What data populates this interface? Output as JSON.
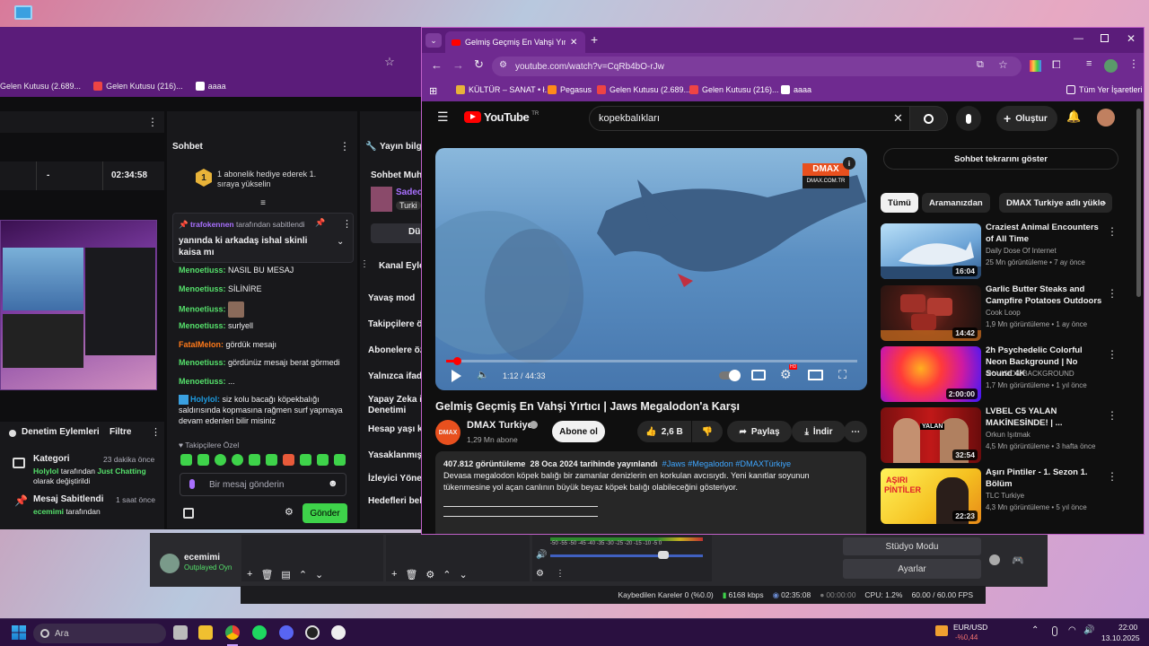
{
  "back_browser": {
    "bookmarks": [
      {
        "label": "Gelen Kutusu (2.689..."
      },
      {
        "label": "Gelen Kutusu (216)..."
      },
      {
        "label": "aaaa"
      }
    ],
    "stream_timer": "02:34:58",
    "stat_dash": "-",
    "chat": {
      "title": "Sohbet",
      "gift_text": "1 abonelik hediye ederek 1. sıraya yükselin",
      "gift_count": "1",
      "pinned_by_name": "trafokennen",
      "pinned_by_suffix": "tarafından sabitlendi",
      "pinned_text": "yanında ki arkadaş ishal skinli kaisa mı",
      "messages": [
        {
          "name": "Menoetiuss:",
          "text": "NASIL BU MESAJ",
          "color": "#55e06b"
        },
        {
          "name": "Menoetiuss:",
          "text": "SİLİNİRE",
          "color": "#55e06b"
        },
        {
          "name": "Menoetiuss:",
          "text": "",
          "color": "#55e06b"
        },
        {
          "name": "Menoetiuss:",
          "text": "surlyell",
          "color": "#55e06b"
        },
        {
          "name": "FatalMelon:",
          "text": "gördük mesajı",
          "color": "#ff7a1a"
        },
        {
          "name": "Menoetiuss:",
          "text": "gördünüz mesajı berat görmedi",
          "color": "#55e06b"
        },
        {
          "name": "Menoetiuss:",
          "text": "...",
          "color": "#55e06b"
        }
      ],
      "holy_name": "Holylol:",
      "holy_text": "siz kolu bacağı köpekbalığı saldırısında kopmasına rağmen surf yapmaya devam edenleri bilir misiniz",
      "followers_label": "Takipçilere Özel",
      "input_placeholder": "Bir mesaj gönderin",
      "send_label": "Gönder"
    },
    "info": {
      "title": "Yayın bilgi",
      "chat_label": "Sohbet Muh",
      "user_label": "Sadec",
      "tag_label": "Turki",
      "button_label": "Dü",
      "events_title": "Kanal Eyle",
      "items": [
        "Yavaş mod",
        "Takipçilere ö",
        "Abonelere öz",
        "Yalnızca ifad",
        "Yapay Zeka il",
        "Denetimi",
        "Hesap yaşı k",
        "Yasaklanmış",
        "İzleyici Yöne",
        "Hedefleri beli"
      ]
    },
    "moderation": {
      "title": "Denetim Eylemleri",
      "filter": "Filtre",
      "items": [
        {
          "title": "Kategori",
          "time": "23 dakika önce",
          "user": "Holylol",
          "mid": "tarafından",
          "target": "Just Chatting",
          "rest": "olarak değiştirildi"
        },
        {
          "title": "Mesaj Sabitlendi",
          "time": "1 saat önce",
          "user": "ecemimi",
          "mid": "tarafından",
          "target": "",
          "rest": ""
        }
      ]
    }
  },
  "front_browser": {
    "tab_title": "Gelmiş Geçmiş En Vahşi Yırtıcı |",
    "url": "youtube.com/watch?v=CqRb4bO-rJw",
    "bookmarks": [
      "KÜLTÜR – SANAT • ł...",
      "Pegasus",
      "Gelen Kutusu (2.689...",
      "Gelen Kutusu (216)...",
      "aaaa"
    ],
    "all_bookmarks": "Tüm Yer İşaretleri",
    "youtube": {
      "logo": "YouTube",
      "region": "TR",
      "search_value": "kopekbalıkları",
      "create_label": "Oluştur",
      "channel_badge": "DMAX",
      "channel_badge_sub": "DMAX.COM.TR",
      "time": "1:12 / 44:33",
      "progress": 0.027,
      "hd": "HD",
      "video_title": "Gelmiş Geçmiş En Vahşi Yırtıcı | Jaws Megalodon'a Karşı",
      "channel_name": "DMAX Turkiye",
      "channel_logo": "DMAX",
      "subs": "1,29 Mn abone",
      "subscribe": "Abone ol",
      "likes": "2,6 B",
      "share": "Paylaş",
      "download": "İndir",
      "views": "407.812 görüntüleme",
      "date": "28 Oca 2024 tarihinde yayınlandı",
      "hashtags": "#Jaws #Megalodon #DMAXTürkiye",
      "description": "Devasa megalodon köpek balığı bir zamanlar denizlerin en korkulan avcısıydı. Yeni kanıtlar soyunun tükenmesine yol açan canlının büyük beyaz köpek balığı olabileceğini gösteriyor.",
      "chat_replay": "Sohbet tekrarını göster",
      "chips": [
        "Tümü",
        "Aramanızdan",
        "DMAX Turkiye adlı yükle"
      ],
      "recommended": [
        {
          "title": "Craziest Animal Encounters of All Time",
          "channel": "Daily Dose Of Internet",
          "meta": "25 Mn görüntüleme • 7 ay önce",
          "duration": "16:04",
          "c1": "#9fd0f0",
          "c2": "#3b6ea8"
        },
        {
          "title": "Garlic Butter Steaks and Campfire Potatoes Outdoors",
          "channel": "Cook Loop",
          "meta": "1,9 Mn görüntüleme • 1 ay önce",
          "duration": "14:42",
          "c1": "#6a2a1e",
          "c2": "#2b1a14"
        },
        {
          "title": "2h Psychedelic Colorful Neon Background | No Sound 4K",
          "channel": "4K VISION BACKGROUND",
          "meta": "1,7 Mn görüntüleme • 1 yıl önce",
          "duration": "2:00:00",
          "c1": "#ff2aa0",
          "c2": "#5a1aff"
        },
        {
          "title": "LVBEL C5 YALAN MAKİNESİNDE! | ...",
          "channel": "Orkun Işıtmak",
          "meta": "4,5 Mn görüntüleme • 3 hafta önce",
          "duration": "32:54",
          "c1": "#c81818",
          "c2": "#3a0c0c"
        },
        {
          "title": "Aşırı Pintiler - 1. Sezon 1. Bölüm",
          "channel": "TLC Turkiye",
          "meta": "4,3 Mn görüntüleme • 5 yıl önce",
          "duration": "22:23",
          "c1": "#f5e020",
          "c2": "#e89018"
        }
      ],
      "thumb_text_4": "YALAN",
      "thumb_text_5a": "AŞIRI",
      "thumb_text_5b": "PİNTİLER"
    }
  },
  "obs": {
    "user_name": "ecemimi",
    "user_sub": "Outplayed Oyn",
    "studio_mode": "Stüdyo Modu",
    "settings": "Ayarlar",
    "meter_ticks": "-50 -55 -50 -45 -40 -35 -30 -25 -20 -15 -10 -5 0",
    "status": {
      "dropped": "Kaybedilen Kareler 0 (%0.0)",
      "bitrate": "6168 kbps",
      "rec_time": "02:35:08",
      "stream_time": "00:00:00",
      "cpu": "CPU: 1.2%",
      "fps": "60.00 / 60.00 FPS"
    }
  },
  "taskbar": {
    "search": "Ara",
    "ticker": "EUR/USD",
    "ticker_change": "-%0,44",
    "time": "22:00",
    "date": "13.10.2025"
  }
}
